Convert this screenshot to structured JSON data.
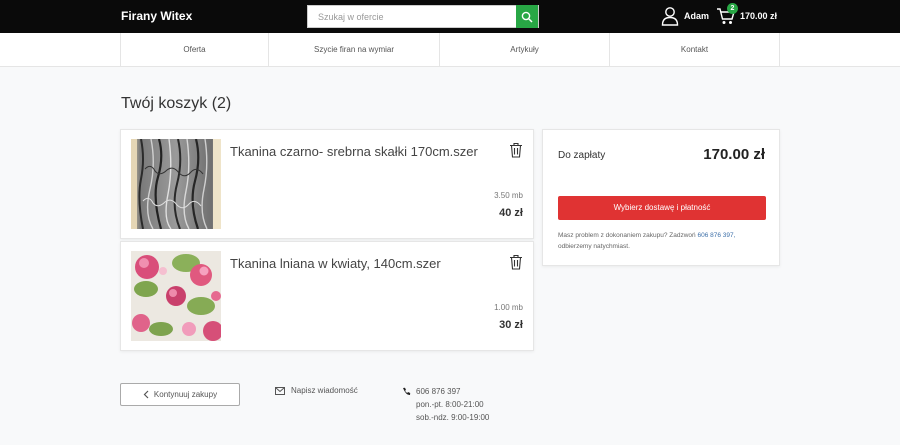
{
  "header": {
    "brand": "Firany Witex",
    "search_placeholder": "Szukaj w ofercie",
    "user_name": "Adam",
    "cart_count": "2",
    "cart_total": "170.00 zł"
  },
  "nav": {
    "items": [
      {
        "label": "Oferta"
      },
      {
        "label": "Szycie firan na wymiar"
      },
      {
        "label": "Artykuły"
      },
      {
        "label": "Kontakt"
      }
    ]
  },
  "page_title": "Twój koszyk (2)",
  "cart": {
    "items": [
      {
        "name": "Tkanina czarno- srebrna skałki 170cm.szer",
        "qty": "3.50 mb",
        "price": "40 zł"
      },
      {
        "name": "Tkanina lniana w kwiaty, 140cm.szer",
        "qty": "1.00 mb",
        "price": "30 zł"
      }
    ]
  },
  "summary": {
    "label": "Do zapłaty",
    "total": "170.00 zł",
    "checkout_label": "Wybierz dostawę i płatność",
    "help_text": "Masz problem z dokonaniem zakupu? Zadzwoń",
    "help_phone": "606 876 397,",
    "help_suffix": "odbierzemy natychmiast."
  },
  "footer": {
    "continue_label": "Kontynuuj zakupy",
    "message_label": "Napisz wiadomość",
    "phone": "606 876 397",
    "hours_weekday": "pon.-pt. 8:00-21:00",
    "hours_weekend": "sob.-ndz. 9:00-19:00"
  },
  "colors": {
    "accent_green": "#28a745",
    "checkout_red": "#e03333",
    "header_bg": "#0a0a0a"
  }
}
